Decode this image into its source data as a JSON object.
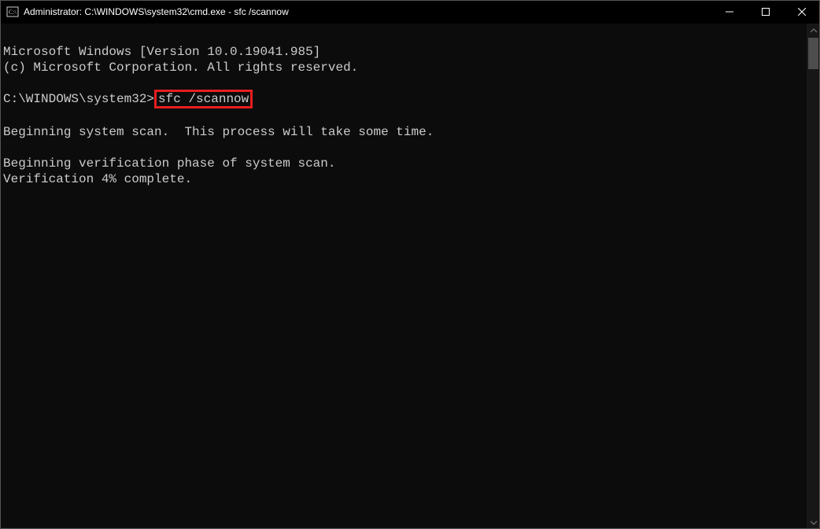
{
  "window": {
    "title": "Administrator: C:\\WINDOWS\\system32\\cmd.exe - sfc  /scannow"
  },
  "console": {
    "line1": "Microsoft Windows [Version 10.0.19041.985]",
    "line2": "(c) Microsoft Corporation. All rights reserved.",
    "blank": "",
    "prompt_prefix": "C:\\WINDOWS\\system32>",
    "prompt_cmd": "sfc /scannow",
    "line_scan1": "Beginning system scan.  This process will take some time.",
    "line_scan2": "Beginning verification phase of system scan.",
    "line_scan3": "Verification 4% complete."
  }
}
